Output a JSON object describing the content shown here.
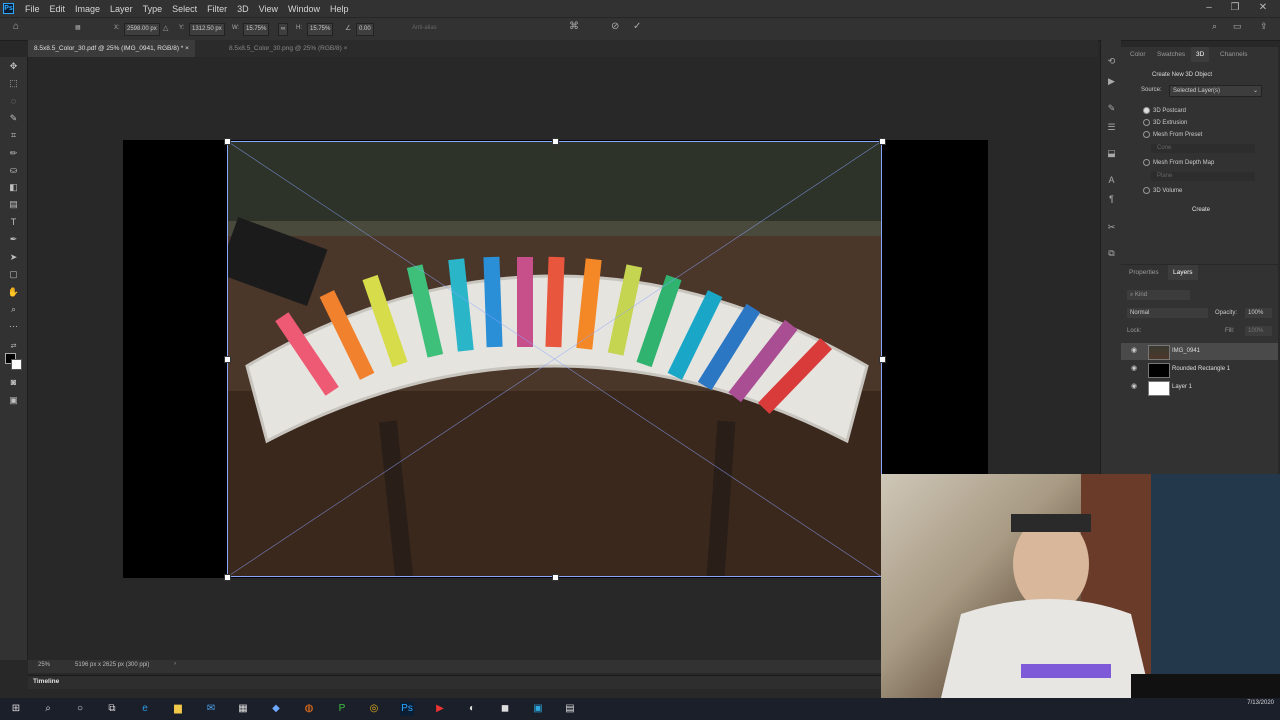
{
  "app": {
    "logo": "Ps"
  },
  "menu": [
    "File",
    "Edit",
    "Image",
    "Layer",
    "Type",
    "Select",
    "Filter",
    "3D",
    "View",
    "Window",
    "Help"
  ],
  "options": {
    "x_label": "X:",
    "x_value": "2598.00 px",
    "y_label": "Y:",
    "y_value": "1312.50 px",
    "w_label": "W:",
    "w_value": "15.75%",
    "h_label": "H:",
    "h_value": "15.75%",
    "angle_value": "0.00",
    "interp": "Anti-alias"
  },
  "tabs": [
    {
      "label": "8.5x8.5_Color_30.pdf @ 25% (IMG_0941, RGB/8) *"
    },
    {
      "label": "8.5x8.5_Color_30.png @ 25% (RGB/8)"
    }
  ],
  "statusbar": {
    "zoom": "25%",
    "doc_info": "5196 px x 2625 px (300 ppi)"
  },
  "timeline": {
    "label": "Timeline"
  },
  "panel3d": {
    "tabs": [
      "Color",
      "Swatches",
      "3D",
      "Channels"
    ],
    "header": "Create New 3D Object",
    "source_label": "Source:",
    "source_value": "Selected Layer(s)",
    "options": [
      "3D Postcard",
      "3D Extrusion",
      "Mesh From Preset",
      "Cone",
      "Mesh From Depth Map",
      "Plane",
      "3D Volume"
    ],
    "create_button": "Create"
  },
  "layers": {
    "tabs": [
      "Properties",
      "Layers"
    ],
    "kind": "Kind",
    "blend_mode": "Normal",
    "opacity_label": "Opacity:",
    "opacity_value": "100%",
    "lock_label": "Lock:",
    "fill_label": "Fill:",
    "fill_value": "100%",
    "items": [
      {
        "name": "IMG_0941"
      },
      {
        "name": "Rounded Rectangle 1"
      },
      {
        "name": "Layer 1"
      }
    ]
  },
  "taskbar": {
    "time": "",
    "date": "7/13/2020"
  }
}
